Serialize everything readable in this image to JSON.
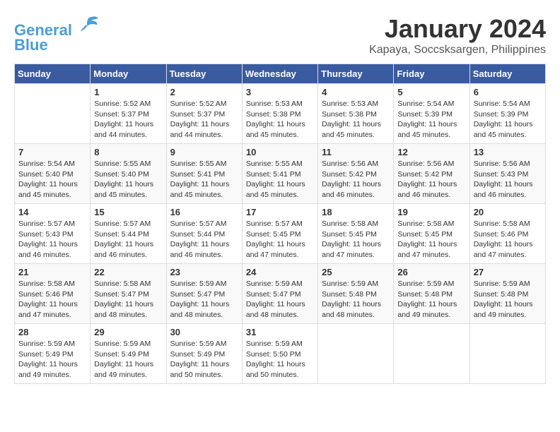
{
  "header": {
    "logo_line1": "General",
    "logo_line2": "Blue",
    "month": "January 2024",
    "location": "Kapaya, Soccsksargen, Philippines"
  },
  "columns": [
    "Sunday",
    "Monday",
    "Tuesday",
    "Wednesday",
    "Thursday",
    "Friday",
    "Saturday"
  ],
  "weeks": [
    [
      {
        "day": "",
        "sunrise": "",
        "sunset": "",
        "daylight": ""
      },
      {
        "day": "1",
        "sunrise": "5:52 AM",
        "sunset": "5:37 PM",
        "daylight": "11 hours and 44 minutes."
      },
      {
        "day": "2",
        "sunrise": "5:52 AM",
        "sunset": "5:37 PM",
        "daylight": "11 hours and 44 minutes."
      },
      {
        "day": "3",
        "sunrise": "5:53 AM",
        "sunset": "5:38 PM",
        "daylight": "11 hours and 45 minutes."
      },
      {
        "day": "4",
        "sunrise": "5:53 AM",
        "sunset": "5:38 PM",
        "daylight": "11 hours and 45 minutes."
      },
      {
        "day": "5",
        "sunrise": "5:54 AM",
        "sunset": "5:39 PM",
        "daylight": "11 hours and 45 minutes."
      },
      {
        "day": "6",
        "sunrise": "5:54 AM",
        "sunset": "5:39 PM",
        "daylight": "11 hours and 45 minutes."
      }
    ],
    [
      {
        "day": "7",
        "sunrise": "5:54 AM",
        "sunset": "5:40 PM",
        "daylight": "11 hours and 45 minutes."
      },
      {
        "day": "8",
        "sunrise": "5:55 AM",
        "sunset": "5:40 PM",
        "daylight": "11 hours and 45 minutes."
      },
      {
        "day": "9",
        "sunrise": "5:55 AM",
        "sunset": "5:41 PM",
        "daylight": "11 hours and 45 minutes."
      },
      {
        "day": "10",
        "sunrise": "5:55 AM",
        "sunset": "5:41 PM",
        "daylight": "11 hours and 45 minutes."
      },
      {
        "day": "11",
        "sunrise": "5:56 AM",
        "sunset": "5:42 PM",
        "daylight": "11 hours and 46 minutes."
      },
      {
        "day": "12",
        "sunrise": "5:56 AM",
        "sunset": "5:42 PM",
        "daylight": "11 hours and 46 minutes."
      },
      {
        "day": "13",
        "sunrise": "5:56 AM",
        "sunset": "5:43 PM",
        "daylight": "11 hours and 46 minutes."
      }
    ],
    [
      {
        "day": "14",
        "sunrise": "5:57 AM",
        "sunset": "5:43 PM",
        "daylight": "11 hours and 46 minutes."
      },
      {
        "day": "15",
        "sunrise": "5:57 AM",
        "sunset": "5:44 PM",
        "daylight": "11 hours and 46 minutes."
      },
      {
        "day": "16",
        "sunrise": "5:57 AM",
        "sunset": "5:44 PM",
        "daylight": "11 hours and 46 minutes."
      },
      {
        "day": "17",
        "sunrise": "5:57 AM",
        "sunset": "5:45 PM",
        "daylight": "11 hours and 47 minutes."
      },
      {
        "day": "18",
        "sunrise": "5:58 AM",
        "sunset": "5:45 PM",
        "daylight": "11 hours and 47 minutes."
      },
      {
        "day": "19",
        "sunrise": "5:58 AM",
        "sunset": "5:45 PM",
        "daylight": "11 hours and 47 minutes."
      },
      {
        "day": "20",
        "sunrise": "5:58 AM",
        "sunset": "5:46 PM",
        "daylight": "11 hours and 47 minutes."
      }
    ],
    [
      {
        "day": "21",
        "sunrise": "5:58 AM",
        "sunset": "5:46 PM",
        "daylight": "11 hours and 47 minutes."
      },
      {
        "day": "22",
        "sunrise": "5:58 AM",
        "sunset": "5:47 PM",
        "daylight": "11 hours and 48 minutes."
      },
      {
        "day": "23",
        "sunrise": "5:59 AM",
        "sunset": "5:47 PM",
        "daylight": "11 hours and 48 minutes."
      },
      {
        "day": "24",
        "sunrise": "5:59 AM",
        "sunset": "5:47 PM",
        "daylight": "11 hours and 48 minutes."
      },
      {
        "day": "25",
        "sunrise": "5:59 AM",
        "sunset": "5:48 PM",
        "daylight": "11 hours and 48 minutes."
      },
      {
        "day": "26",
        "sunrise": "5:59 AM",
        "sunset": "5:48 PM",
        "daylight": "11 hours and 49 minutes."
      },
      {
        "day": "27",
        "sunrise": "5:59 AM",
        "sunset": "5:48 PM",
        "daylight": "11 hours and 49 minutes."
      }
    ],
    [
      {
        "day": "28",
        "sunrise": "5:59 AM",
        "sunset": "5:49 PM",
        "daylight": "11 hours and 49 minutes."
      },
      {
        "day": "29",
        "sunrise": "5:59 AM",
        "sunset": "5:49 PM",
        "daylight": "11 hours and 49 minutes."
      },
      {
        "day": "30",
        "sunrise": "5:59 AM",
        "sunset": "5:49 PM",
        "daylight": "11 hours and 50 minutes."
      },
      {
        "day": "31",
        "sunrise": "5:59 AM",
        "sunset": "5:50 PM",
        "daylight": "11 hours and 50 minutes."
      },
      {
        "day": "",
        "sunrise": "",
        "sunset": "",
        "daylight": ""
      },
      {
        "day": "",
        "sunrise": "",
        "sunset": "",
        "daylight": ""
      },
      {
        "day": "",
        "sunrise": "",
        "sunset": "",
        "daylight": ""
      }
    ]
  ],
  "labels": {
    "sunrise_prefix": "Sunrise: ",
    "sunset_prefix": "Sunset: ",
    "daylight_prefix": "Daylight: "
  }
}
